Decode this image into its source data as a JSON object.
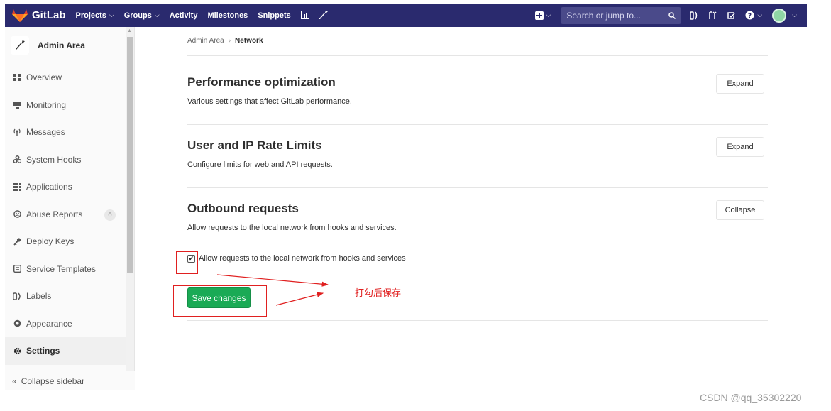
{
  "colors": {
    "navbar": "#2a2a6e",
    "accent_green": "#1aaa55",
    "annotation_red": "#e02020"
  },
  "navbar": {
    "brand": "GitLab",
    "items": [
      {
        "label": "Projects",
        "dropdown": true
      },
      {
        "label": "Groups",
        "dropdown": true
      },
      {
        "label": "Activity",
        "dropdown": false
      },
      {
        "label": "Milestones",
        "dropdown": false
      },
      {
        "label": "Snippets",
        "dropdown": false
      }
    ],
    "icons": [
      "chart-icon",
      "wrench-icon"
    ],
    "search_placeholder": "Search or jump to...",
    "right_icons": [
      "plus-square-icon",
      "issues-icon",
      "merge-request-icon",
      "todo-icon",
      "help-icon",
      "avatar"
    ]
  },
  "sidebar": {
    "title": "Admin Area",
    "items": [
      {
        "label": "Overview",
        "icon": "overview-icon"
      },
      {
        "label": "Monitoring",
        "icon": "monitor-icon"
      },
      {
        "label": "Messages",
        "icon": "broadcast-icon"
      },
      {
        "label": "System Hooks",
        "icon": "hook-icon"
      },
      {
        "label": "Applications",
        "icon": "grid-icon"
      },
      {
        "label": "Abuse Reports",
        "icon": "abuse-icon",
        "badge": "0"
      },
      {
        "label": "Deploy Keys",
        "icon": "key-icon"
      },
      {
        "label": "Service Templates",
        "icon": "template-icon"
      },
      {
        "label": "Labels",
        "icon": "labels-icon"
      },
      {
        "label": "Appearance",
        "icon": "appearance-icon"
      },
      {
        "label": "Settings",
        "icon": "settings-icon",
        "active": true
      }
    ],
    "collapse_label": "Collapse sidebar"
  },
  "breadcrumb": {
    "parent": "Admin Area",
    "separator": "›",
    "current": "Network"
  },
  "sections": [
    {
      "title": "Performance optimization",
      "description": "Various settings that affect GitLab performance.",
      "button": "Expand"
    },
    {
      "title": "User and IP Rate Limits",
      "description": "Configure limits for web and API requests.",
      "button": "Expand"
    },
    {
      "title": "Outbound requests",
      "description": "Allow requests to the local network from hooks and services.",
      "button": "Collapse"
    }
  ],
  "outbound": {
    "checkbox_label": "Allow requests to the local network from hooks and services",
    "checkbox_checked": true,
    "save_label": "Save changes"
  },
  "annotation": {
    "text": "打勾后保存"
  },
  "watermark": "CSDN @qq_35302220"
}
